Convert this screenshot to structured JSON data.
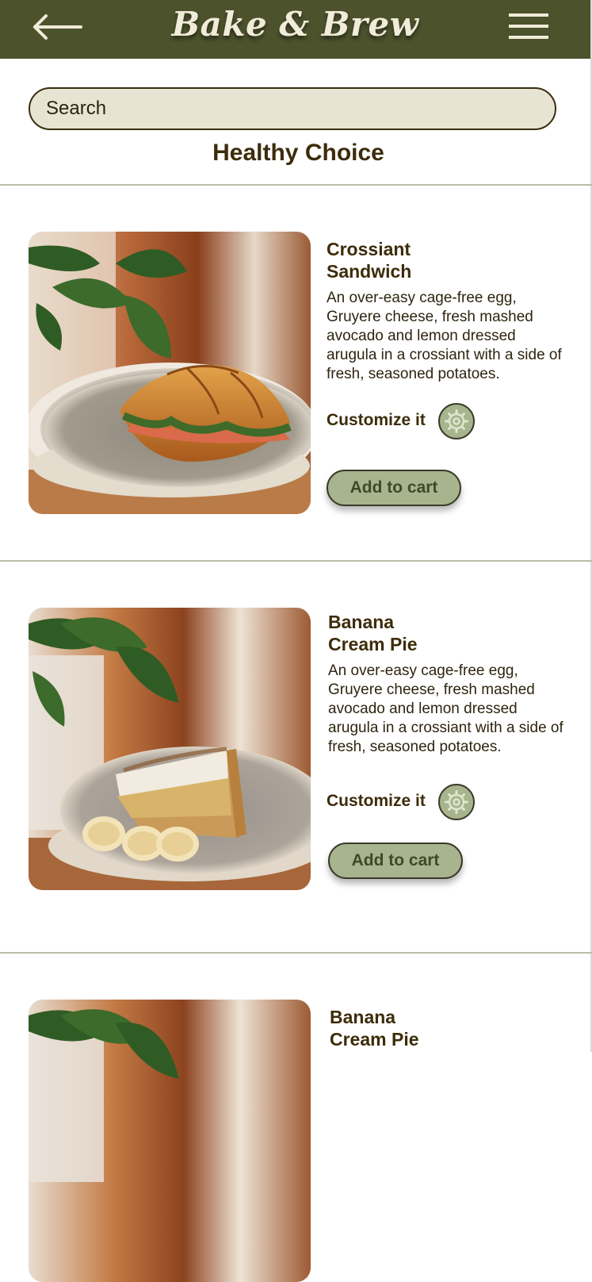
{
  "header": {
    "brand": "Bake & Brew",
    "back_icon": "arrow-left-icon",
    "menu_icon": "hamburger-menu-icon",
    "background_color": "#4b522c"
  },
  "search": {
    "placeholder": "Search"
  },
  "section": {
    "title": "Healthy Choice"
  },
  "products": [
    {
      "name": "Crossiant\nSandwich",
      "description": "An over-easy cage-free egg, Gruyere cheese, fresh mashed avocado and lemon dressed arugula in a crossiant with a side of fresh, seasoned potatoes.",
      "customize_label": "Customize it",
      "customize_icon": "gear-icon",
      "cart_label": "Add to cart"
    },
    {
      "name": "Banana\nCream Pie",
      "description": "An over-easy cage-free egg, Gruyere cheese, fresh mashed avocado and lemon dressed arugula in a crossiant with a side of fresh, seasoned potatoes.",
      "customize_label": "Customize it",
      "customize_icon": "gear-icon",
      "cart_label": "Add to cart"
    },
    {
      "name": "Banana\nCream Pie"
    }
  ],
  "colors": {
    "accent": "#a7b48d",
    "text": "#3d2c0a",
    "search_fill": "#e8e4d3"
  }
}
